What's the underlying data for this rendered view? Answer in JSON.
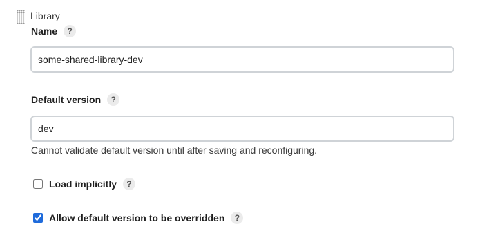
{
  "section": {
    "title": "Library"
  },
  "name_field": {
    "label": "Name",
    "help": "?",
    "value": "some-shared-library-dev"
  },
  "default_version_field": {
    "label": "Default version",
    "help": "?",
    "value": "dev",
    "hint": "Cannot validate default version until after saving and reconfiguring."
  },
  "load_implicitly": {
    "label": "Load implicitly",
    "help": "?",
    "checked": false
  },
  "allow_override": {
    "label": "Allow default version to be overridden",
    "help": "?",
    "checked": true
  },
  "colors": {
    "checkbox_accent": "#1f6bdb",
    "input_border": "#cfd3d7",
    "help_bg": "#ebebeb"
  }
}
